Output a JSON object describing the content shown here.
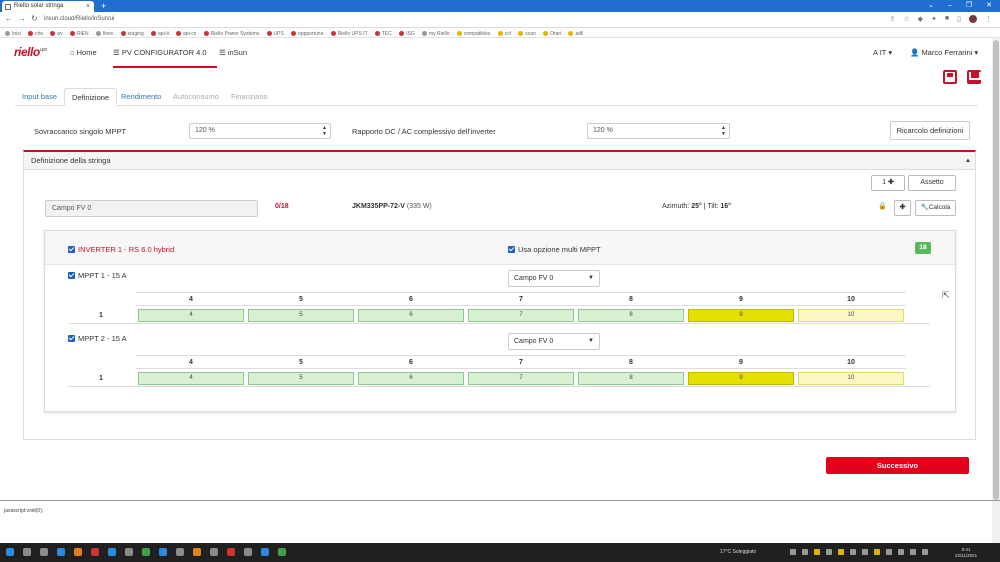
{
  "browser": {
    "tab_title": "Riello solar stringa",
    "url": "insun.cloud/Riello/inSun/ui",
    "bookmarks": [
      "Inizi",
      "che",
      "pv",
      "RiEN",
      "Ilnov",
      "staging",
      "api-ti",
      "api-cs",
      "Riello Power Systems",
      "UPS",
      "oppportuna",
      "Riello UPS IT",
      "TEC",
      "ISG",
      "my Riello",
      "compatibles",
      "ccf",
      "scan",
      "Orari",
      "adli"
    ]
  },
  "header": {
    "logo": "riello",
    "logo_sup": "ups",
    "nav": {
      "home": "Home",
      "pv_configurator": "PV CONFIGURATOR 4.0",
      "insun": "inSun"
    },
    "lang": "IT",
    "user": "Marco Ferrarini"
  },
  "tabs": [
    {
      "label": "Input base",
      "state": "link"
    },
    {
      "label": "Definizione",
      "state": "active"
    },
    {
      "label": "Rendimento",
      "state": "link"
    },
    {
      "label": "Autoconsumo",
      "state": "disabled"
    },
    {
      "label": "Finanziario",
      "state": "disabled"
    }
  ],
  "settings": {
    "sovraccarico_label": "Sovraccarico singolo MPPT",
    "sovraccarico_value": "120 %",
    "rapporto_label": "Rapporto DC / AC complessivo dell'inverter",
    "rapporto_value": "120 %",
    "recalc_label": "Ricarcolo definizioni"
  },
  "panel": {
    "title": "Definizione della stringa",
    "add_button": "1",
    "assetto_button": "Assetto",
    "campo_name": "Campo FV 0",
    "count": "0/18",
    "module_name": "JKM335PP-72-V",
    "module_watt": "(335 W)",
    "azimuth_label": "Azimuth:",
    "azimuth_value": "25°",
    "tilt_label": "| Tilt:",
    "tilt_value": "16°",
    "calcola_label": "Calcola"
  },
  "inverter": {
    "label": "INVERTER 1 - RS 6.0 hybrid",
    "multi_mppt_label": "Usa opzione multi MPPT",
    "badge": "18",
    "mppts": [
      {
        "label": "MPPT 1 - 15 A",
        "campo": "Campo FV 0",
        "columns": [
          "4",
          "5",
          "6",
          "7",
          "8",
          "9",
          "10"
        ],
        "row_label": "1",
        "cells": [
          {
            "value": "4",
            "state": "green"
          },
          {
            "value": "5",
            "state": "green"
          },
          {
            "value": "6",
            "state": "green"
          },
          {
            "value": "7",
            "state": "green"
          },
          {
            "value": "8",
            "state": "green"
          },
          {
            "value": "9",
            "state": "yellow"
          },
          {
            "value": "10",
            "state": "light-yellow"
          }
        ]
      },
      {
        "label": "MPPT 2 - 15 A",
        "campo": "Campo FV 0",
        "columns": [
          "4",
          "5",
          "6",
          "7",
          "8",
          "9",
          "10"
        ],
        "row_label": "1",
        "cells": [
          {
            "value": "4",
            "state": "green"
          },
          {
            "value": "5",
            "state": "green"
          },
          {
            "value": "6",
            "state": "green"
          },
          {
            "value": "7",
            "state": "green"
          },
          {
            "value": "8",
            "state": "green"
          },
          {
            "value": "9",
            "state": "yellow"
          },
          {
            "value": "10",
            "state": "light-yellow"
          }
        ]
      }
    ]
  },
  "footer": {
    "next_button": "Successivo",
    "status_text": "javascript:void(0);"
  },
  "taskbar": {
    "weather": "17°C Soleggiato",
    "time": "9:41",
    "date": "22/11/2021"
  },
  "colors": {
    "brand_red": "#c8102e",
    "next_red": "#e3001b",
    "link_blue": "#337ab7",
    "check_blue": "#1e5fbf",
    "badge_green": "#5cb85c",
    "cell_green": "#d7f0d2",
    "cell_yellow": "#e6e000",
    "cell_light_yellow": "#fbf7c4"
  }
}
